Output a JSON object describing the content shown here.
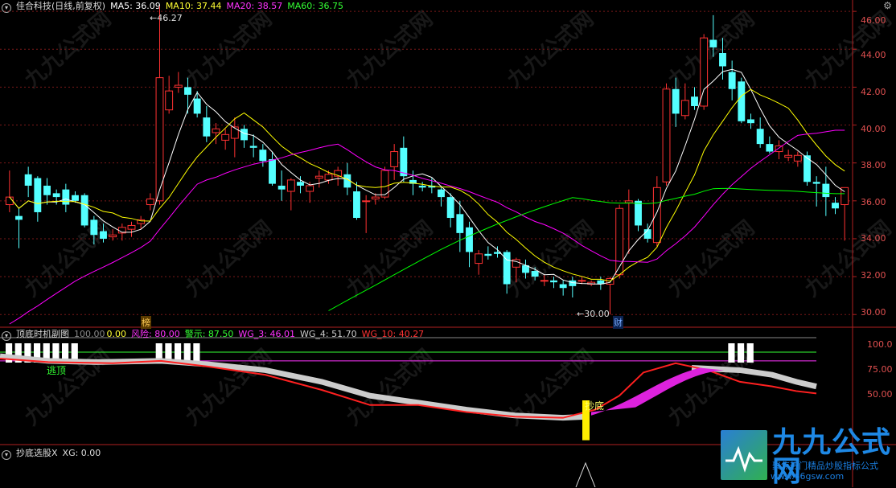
{
  "main_panel": {
    "title": "佳合科技(日线,前复权)",
    "ma5": "MA5: 36.09",
    "ma10": "MA10: 37.44",
    "ma20": "MA20: 38.57",
    "ma60": "MA60: 36.75",
    "high_note": "46.27",
    "low_note": "30.00",
    "tag_bang": "榜",
    "tag_cai": "财",
    "y_ticks": [
      "46.00",
      "44.00",
      "42.00",
      "40.00",
      "38.00",
      "36.00",
      "34.00",
      "32.00",
      "30.00"
    ],
    "colors": {
      "ma5": "#ffffff",
      "ma10": "#ffff00",
      "ma20": "#ff00ff",
      "ma60": "#00ff00",
      "up": "#ff3232",
      "down": "#54ffff"
    }
  },
  "sub_panel": {
    "title": "顶底时机副图",
    "v1": "100.00",
    "v2": "0.00",
    "risk": "风险: 80.00",
    "warn": "警示: 87.50",
    "wg3": "WG_3: 46.01",
    "wg4": "WG_4: 51.70",
    "wg10": "WG_10: 40.27",
    "escape_label": "逃顶",
    "bottom_label": "抄底",
    "y_ticks": [
      "100.0",
      "75.00",
      "50.00"
    ]
  },
  "third_panel": {
    "title": "抄底选股X",
    "xg": "XG: 0.00"
  },
  "watermark": {
    "title": "九九公式网",
    "sub": "聚焦热门精品炒股指标公式",
    "url": "www.66gsw.com"
  },
  "chart_data": {
    "type": "candlestick",
    "ylim": [
      29.5,
      46.6
    ],
    "candles": [
      [
        35.8,
        37.6,
        35.4,
        36.2
      ],
      [
        35.2,
        35.6,
        33.5,
        35.0
      ],
      [
        37.4,
        37.8,
        36.2,
        36.8
      ],
      [
        37.2,
        37.3,
        34.9,
        35.4
      ],
      [
        36.8,
        37.2,
        35.8,
        36.3
      ],
      [
        36.4,
        36.6,
        35.8,
        36.2
      ],
      [
        36.6,
        36.9,
        35.4,
        35.8
      ],
      [
        36.3,
        36.5,
        35.9,
        36.0
      ],
      [
        36.3,
        36.4,
        34.6,
        34.7
      ],
      [
        35.0,
        35.2,
        33.7,
        34.2
      ],
      [
        34.4,
        34.8,
        33.8,
        34.0
      ],
      [
        34.1,
        34.5,
        33.9,
        34.2
      ],
      [
        34.3,
        34.8,
        33.9,
        34.6
      ],
      [
        34.5,
        34.9,
        34.1,
        34.7
      ],
      [
        34.8,
        35.2,
        34.5,
        35.0
      ],
      [
        35.8,
        36.4,
        35.5,
        36.1
      ],
      [
        36.0,
        46.27,
        35.8,
        42.5
      ],
      [
        40.8,
        42.6,
        40.6,
        41.8
      ],
      [
        42.0,
        42.8,
        41.7,
        42.1
      ],
      [
        42.0,
        42.5,
        40.6,
        41.6
      ],
      [
        41.4,
        41.8,
        40.4,
        40.6
      ],
      [
        40.4,
        41.0,
        39.1,
        39.4
      ],
      [
        39.6,
        40.1,
        39.0,
        39.8
      ],
      [
        39.2,
        39.8,
        38.7,
        39.5
      ],
      [
        39.3,
        40.4,
        38.3,
        39.9
      ],
      [
        39.8,
        40.0,
        38.8,
        39.2
      ],
      [
        38.9,
        39.5,
        38.3,
        38.8
      ],
      [
        38.7,
        39.0,
        37.8,
        38.1
      ],
      [
        38.2,
        38.6,
        36.8,
        36.9
      ],
      [
        36.8,
        37.6,
        36.0,
        36.6
      ],
      [
        36.5,
        37.2,
        35.5,
        37.1
      ],
      [
        37.0,
        37.3,
        36.4,
        36.8
      ],
      [
        36.5,
        37.0,
        35.9,
        36.8
      ],
      [
        37.2,
        37.6,
        36.7,
        37.3
      ],
      [
        37.1,
        37.6,
        36.9,
        37.4
      ],
      [
        37.3,
        37.8,
        36.8,
        37.6
      ],
      [
        37.4,
        38.0,
        36.3,
        36.7
      ],
      [
        36.5,
        37.0,
        35.0,
        35.1
      ],
      [
        36.0,
        36.3,
        34.3,
        36.0
      ],
      [
        36.1,
        36.4,
        35.8,
        36.2
      ],
      [
        36.2,
        37.8,
        36.1,
        37.6
      ],
      [
        37.8,
        39.0,
        37.1,
        38.6
      ],
      [
        38.8,
        39.4,
        37.0,
        37.3
      ],
      [
        37.1,
        37.6,
        36.3,
        36.9
      ],
      [
        36.8,
        37.0,
        36.5,
        36.7
      ],
      [
        36.8,
        37.2,
        36.4,
        36.7
      ],
      [
        36.6,
        36.8,
        35.7,
        36.2
      ],
      [
        36.2,
        36.4,
        34.6,
        35.1
      ],
      [
        35.3,
        36.0,
        33.3,
        34.3
      ],
      [
        34.6,
        34.9,
        32.5,
        33.3
      ],
      [
        32.7,
        33.4,
        32.1,
        33.2
      ],
      [
        33.2,
        33.6,
        32.9,
        33.1
      ],
      [
        33.3,
        33.6,
        33.0,
        33.2
      ],
      [
        33.3,
        33.4,
        31.1,
        31.6
      ],
      [
        32.5,
        33.0,
        31.7,
        32.9
      ],
      [
        32.6,
        32.9,
        31.9,
        32.2
      ],
      [
        32.3,
        32.5,
        31.8,
        32.0
      ],
      [
        31.8,
        32.1,
        31.5,
        31.8
      ],
      [
        31.8,
        32.0,
        31.4,
        31.7
      ],
      [
        31.6,
        31.8,
        31.0,
        31.4
      ],
      [
        31.8,
        32.0,
        30.9,
        31.5
      ],
      [
        31.8,
        32.0,
        31.6,
        31.8
      ],
      [
        31.6,
        31.8,
        31.5,
        31.7
      ],
      [
        31.8,
        32.0,
        31.3,
        31.6
      ],
      [
        31.6,
        32.0,
        30.0,
        31.9
      ],
      [
        32.1,
        35.8,
        31.9,
        35.6
      ],
      [
        35.9,
        36.6,
        33.2,
        36.0
      ],
      [
        36.0,
        36.1,
        34.4,
        34.7
      ],
      [
        34.5,
        34.8,
        33.8,
        34.0
      ],
      [
        33.8,
        37.3,
        33.6,
        36.7
      ],
      [
        37.0,
        42.2,
        36.8,
        41.9
      ],
      [
        41.9,
        42.5,
        39.9,
        40.6
      ],
      [
        40.5,
        42.2,
        40.3,
        41.3
      ],
      [
        41.5,
        42.0,
        40.8,
        41.0
      ],
      [
        41.0,
        44.8,
        40.8,
        44.6
      ],
      [
        44.5,
        45.8,
        43.6,
        44.1
      ],
      [
        43.8,
        44.6,
        42.4,
        43.1
      ],
      [
        42.8,
        43.4,
        41.3,
        41.9
      ],
      [
        42.3,
        42.5,
        40.1,
        40.2
      ],
      [
        40.3,
        40.6,
        39.8,
        40.1
      ],
      [
        39.8,
        40.4,
        38.8,
        39.0
      ],
      [
        39.0,
        39.4,
        38.5,
        38.6
      ],
      [
        38.6,
        39.2,
        38.2,
        38.9
      ],
      [
        38.3,
        38.7,
        38.1,
        38.4
      ],
      [
        38.1,
        38.6,
        37.8,
        38.4
      ],
      [
        38.4,
        38.6,
        36.8,
        37.0
      ],
      [
        37.0,
        37.3,
        35.7,
        36.9
      ],
      [
        36.9,
        37.8,
        35.2,
        36.2
      ],
      [
        35.9,
        36.2,
        35.3,
        35.6
      ],
      [
        35.8,
        36.7,
        33.9,
        36.7
      ]
    ]
  }
}
